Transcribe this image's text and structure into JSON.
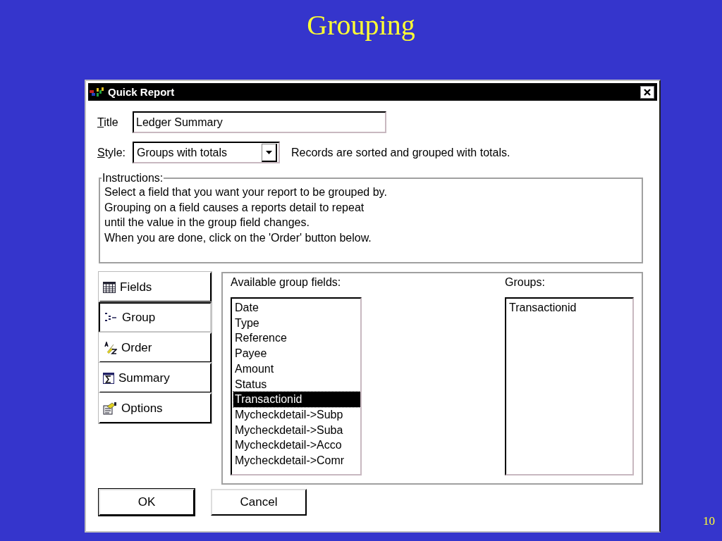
{
  "slide": {
    "title": "Grouping",
    "page_number": "10"
  },
  "window": {
    "title": "Quick Report"
  },
  "title_field": {
    "label": "Title",
    "value": "Ledger Summary"
  },
  "style_field": {
    "label": "Style:",
    "value": "Groups with totals",
    "description": "Records are sorted and grouped with totals."
  },
  "instructions": {
    "legend": "Instructions:",
    "lines": [
      "Select a field that you want your report to be grouped by.",
      "Grouping on a field causes a reports detail to repeat",
      "until the value in the group field changes.",
      "When you are done, click on the 'Order' button below."
    ]
  },
  "modes": [
    {
      "label": "Fields",
      "kind": "fields",
      "selected": false
    },
    {
      "label": "Group",
      "kind": "group",
      "selected": true
    },
    {
      "label": "Order",
      "kind": "order",
      "selected": false
    },
    {
      "label": "Summary",
      "kind": "summary",
      "selected": false
    },
    {
      "label": "Options",
      "kind": "options",
      "selected": false
    }
  ],
  "available": {
    "label": "Available group fields:",
    "items": [
      {
        "text": "Date",
        "selected": false
      },
      {
        "text": "Type",
        "selected": false
      },
      {
        "text": "Reference",
        "selected": false
      },
      {
        "text": "Payee",
        "selected": false
      },
      {
        "text": "Amount",
        "selected": false
      },
      {
        "text": "Status",
        "selected": false
      },
      {
        "text": "Transactionid",
        "selected": true
      },
      {
        "text": "Mycheckdetail->Subp",
        "selected": false
      },
      {
        "text": "Mycheckdetail->Suba",
        "selected": false
      },
      {
        "text": "Mycheckdetail->Acco",
        "selected": false
      },
      {
        "text": "Mycheckdetail->Comr",
        "selected": false
      }
    ]
  },
  "groups": {
    "label": "Groups:",
    "items": [
      "Transactionid"
    ]
  },
  "buttons": [
    "OK",
    "Cancel"
  ]
}
